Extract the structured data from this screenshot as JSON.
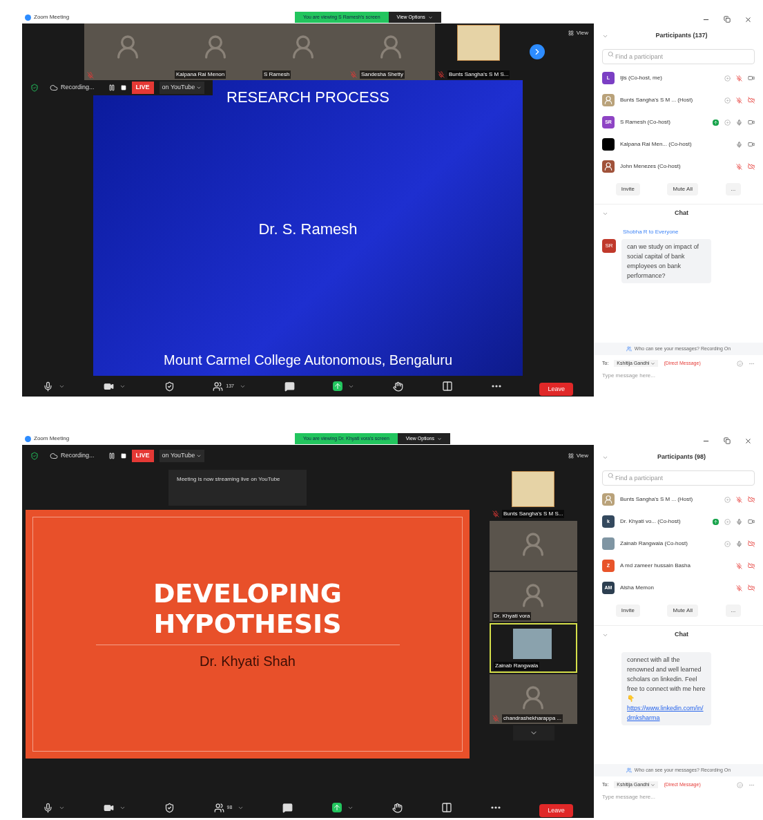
{
  "windows": [
    {
      "title": "Zoom Meeting",
      "kind": "strip",
      "banner": "You are viewing S Ramesh's screen",
      "view_options": "View Options",
      "recording": "Recording...",
      "live": "LIVE",
      "live_target": "on YouTube",
      "view": "View",
      "tiles": [
        {
          "kind": "video",
          "muted": true
        },
        {
          "kind": "video",
          "name": "Kalpana Rai Menon",
          "muted": false
        },
        {
          "kind": "video",
          "name": "S Ramesh",
          "muted": false
        },
        {
          "kind": "video",
          "name": "Sandesha Shetty",
          "muted": true
        },
        {
          "kind": "poster",
          "name": "Bunts Sangha's S M S...",
          "muted": true
        }
      ],
      "slide": {
        "kind": "blue",
        "title": "RESEARCH PROCESS",
        "author": "Dr. S. Ramesh",
        "footer": "Mount Carmel College Autonomous, Bengaluru"
      },
      "participant_count": "137",
      "leave": "Leave",
      "participants": {
        "title": "Participants (137)",
        "search_placeholder": "Find a participant",
        "items": [
          {
            "avatar": "L",
            "kind": "initials",
            "color": "#7b3fc4",
            "name": "Ijis (Co-host, me)",
            "sharing": false,
            "mic_muted": true,
            "video_off": false
          },
          {
            "kind": "picture",
            "color": "#b9a27a",
            "name": "Bunts Sangha's S M ... (Host)",
            "sharing": false,
            "mic_muted": true,
            "video_off": true
          },
          {
            "avatar": "SR",
            "kind": "initials",
            "color": "#8e44c4",
            "name": "S Ramesh (Co-host)",
            "sharing": true,
            "mic_muted": false,
            "video_off": false
          },
          {
            "kind": "initials",
            "color": "#000000",
            "name": "Kalpana Rai Men... (Co-host)",
            "sharing": false,
            "mic_muted": false,
            "video_off": false
          },
          {
            "kind": "picture",
            "color": "#a0523a",
            "name": "John Menezes (Co-host)",
            "sharing": false,
            "mic_muted": true,
            "video_off": true
          }
        ],
        "buttons": [
          "Invite",
          "Mute All",
          "..."
        ]
      },
      "chat": {
        "title": "Chat",
        "sender": "Shobha R to Everyone",
        "sender_avatar": "SR",
        "message": "can we study on impact of social capital of bank employees on bank performance?",
        "notice": "Who can see your messages? Recording On",
        "to_label": "To:",
        "to": "Kshitija Gandhi",
        "direct": "(Direct Message)",
        "placeholder": "Type message here..."
      }
    },
    {
      "title": "Zoom Meeting",
      "kind": "sidebar",
      "banner": "You are viewing Dr. Khyati vora's screen",
      "view_options": "View Options",
      "recording": "Recording...",
      "live": "LIVE",
      "live_target": "on YouTube",
      "view": "View",
      "tooltip": "Meeting is now streaming live on YouTube",
      "tiles": [
        {
          "kind": "poster",
          "name": "Bunts Sangha's S M S...",
          "muted": true,
          "selected": false
        },
        {
          "kind": "video",
          "muted": false,
          "selected": false
        },
        {
          "kind": "video",
          "name": "Dr. Khyati vora",
          "muted": false,
          "selected": false
        },
        {
          "kind": "blurred",
          "name": "Zainab Rangwala",
          "muted": false,
          "selected": true
        },
        {
          "kind": "video",
          "name": "chandrashekharappa ...",
          "muted": true,
          "selected": false
        }
      ],
      "slide": {
        "kind": "orange",
        "title": "DEVELOPING HYPOTHESIS",
        "author": "Dr. Khyati Shah"
      },
      "participant_count": "98",
      "leave": "Leave",
      "participants": {
        "title": "Participants (98)",
        "search_placeholder": "Find a participant",
        "items": [
          {
            "kind": "picture",
            "color": "#b9a27a",
            "name": "Bunts Sangha's S M ... (Host)",
            "sharing": false,
            "mic_muted": true,
            "video_off": true
          },
          {
            "avatar": "k",
            "kind": "initials",
            "color": "#34495e",
            "name": "Dr. Khyati vo... (Co-host)",
            "sharing": true,
            "mic_muted": false,
            "video_off": false
          },
          {
            "kind": "initials",
            "color": "#7f95a3",
            "name": "Zainab Rangwala (Co-host)",
            "sharing": false,
            "mic_muted": false,
            "video_off": true
          },
          {
            "avatar": "Z",
            "kind": "initials",
            "color": "#e8542a",
            "name": "A md zameer hussain Basha",
            "sharing": false,
            "mic_muted": true,
            "video_off": true
          },
          {
            "avatar": "AM",
            "kind": "initials",
            "color": "#2c3e50",
            "name": "Alsha Memon",
            "sharing": false,
            "mic_muted": true,
            "video_off": true
          }
        ],
        "buttons": [
          "Invite",
          "Mute All",
          "..."
        ]
      },
      "chat": {
        "title": "Chat",
        "message": "connect with all the renowned and well learned scholars on linkedin. Feel free to connect with me here 👇",
        "link": "https://www.linkedin.com/in/drnksharma",
        "notice": "Who can see your messages? Recording On",
        "to_label": "To:",
        "to": "Kshitija Gandhi",
        "direct": "(Direct Message)",
        "placeholder": "Type message here..."
      }
    }
  ]
}
